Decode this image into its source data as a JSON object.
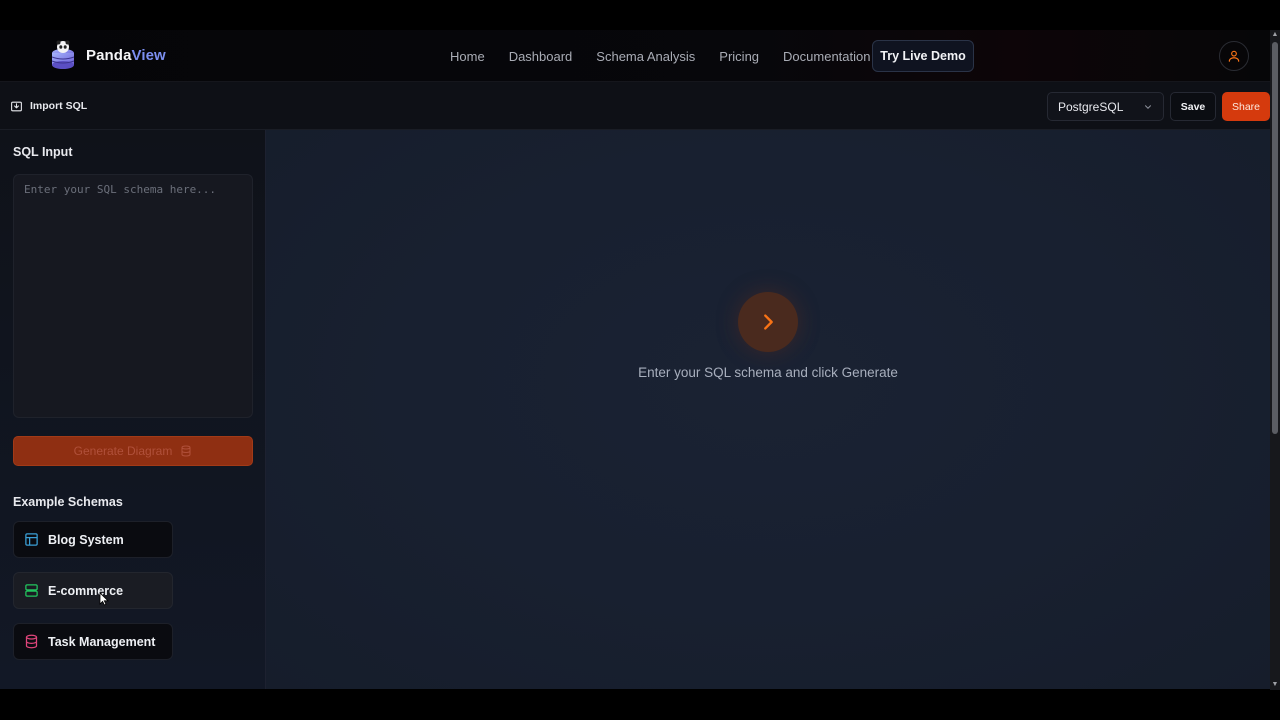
{
  "app": {
    "brand_main": "Panda",
    "brand_accent": "View"
  },
  "nav": {
    "links": [
      "Home",
      "Dashboard",
      "Schema Analysis",
      "Pricing",
      "Documentation"
    ],
    "demo_label": "Try Live Demo"
  },
  "toolbar": {
    "import_label": "Import SQL",
    "db_selected": "PostgreSQL",
    "save_label": "Save",
    "share_label": "Share"
  },
  "sidebar": {
    "sql_title": "SQL Input",
    "sql_placeholder": "Enter your SQL schema here...",
    "sql_value": "",
    "generate_label": "Generate Diagram",
    "examples_title": "Example Schemas",
    "examples": [
      {
        "label": "Blog System",
        "icon": "layout-icon",
        "color": "#3b9fd6"
      },
      {
        "label": "E-commerce",
        "icon": "server-icon",
        "color": "#22c55e"
      },
      {
        "label": "Task Management",
        "icon": "database-icon",
        "color": "#e0457b"
      }
    ]
  },
  "canvas": {
    "empty_message": "Enter your SQL schema and click Generate"
  },
  "colors": {
    "accent": "#d53a0d",
    "brand_accent": "#7c8ff0",
    "icon_orange": "#f97316"
  }
}
